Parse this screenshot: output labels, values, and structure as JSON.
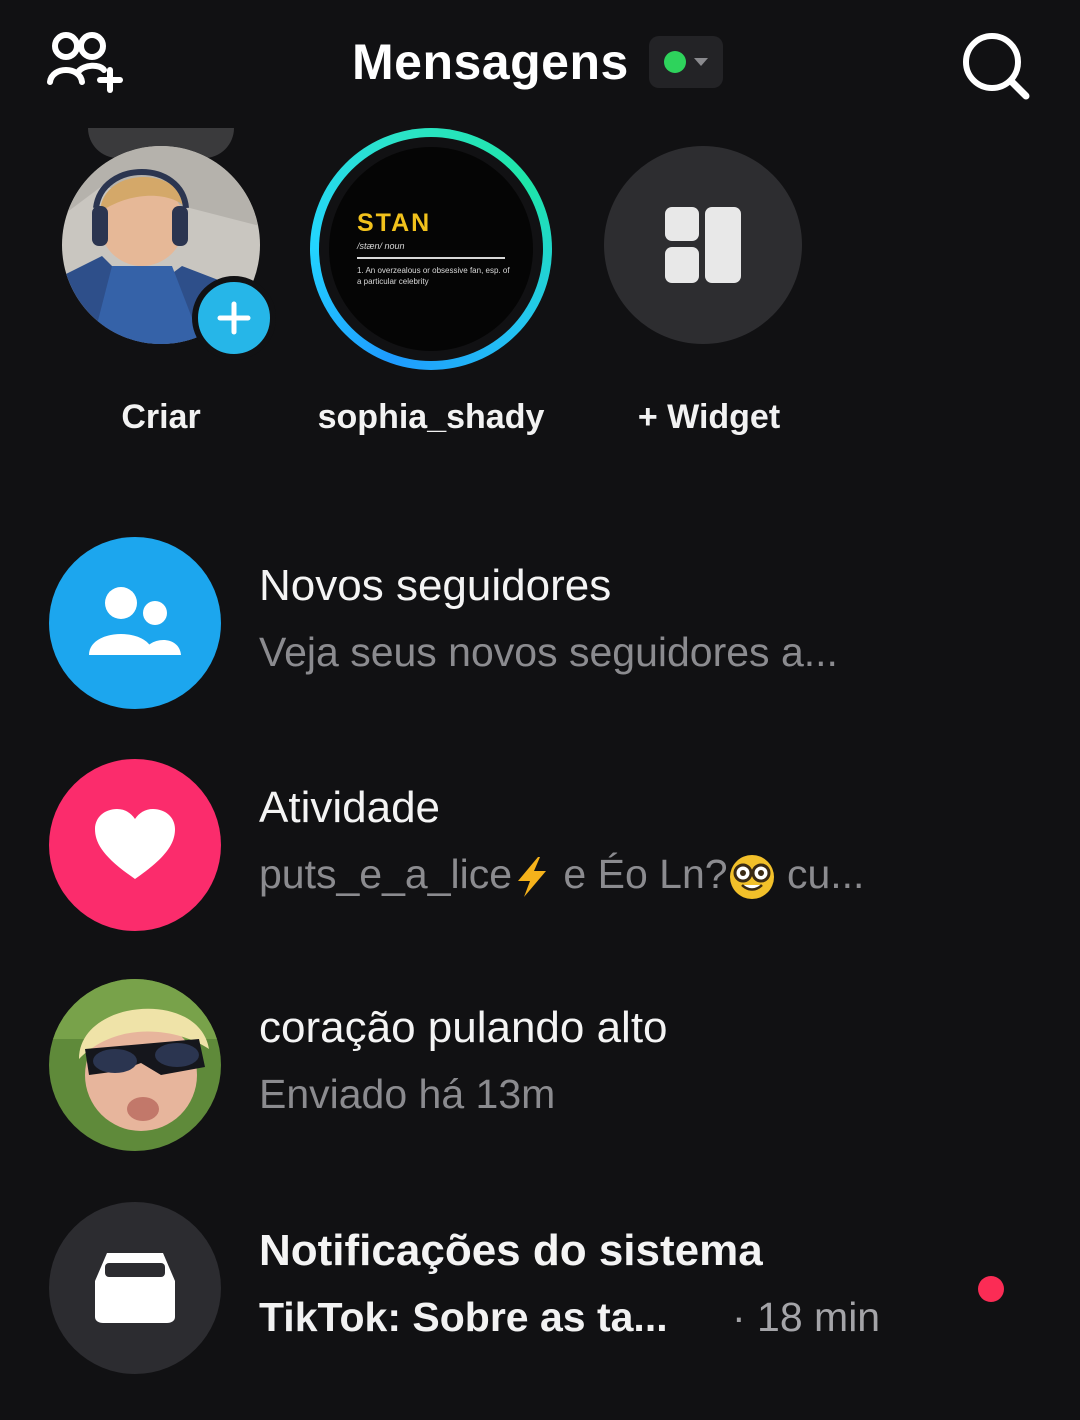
{
  "header": {
    "title": "Mensagens",
    "add_friends_icon": "add-friends-icon",
    "search_icon": "search-icon",
    "status_color": "#2ed35c"
  },
  "stories": [
    {
      "label": "Criar",
      "icon": "add-icon"
    },
    {
      "label": "sophia_shady",
      "card": {
        "word": "STAN",
        "phonetic": "/stæn/ noun",
        "definition": "1. An overzealous or obsessive fan, esp. of a particular celebrity"
      }
    },
    {
      "label": "+ Widget",
      "icon": "widget-icon"
    }
  ],
  "list": [
    {
      "title": "Novos seguidores",
      "subtitle": "Veja seus novos seguidores a...",
      "icon": "followers-icon",
      "color": "#1ca6ee"
    },
    {
      "title": "Atividade",
      "subtitle_parts": [
        "puts_e_a_lice",
        " e Éo Ln?",
        " cu..."
      ],
      "icon": "heart-icon",
      "color": "#fb2c6c"
    },
    {
      "title": "coração pulando alto",
      "subtitle": "Enviado há 13m"
    },
    {
      "title": "Notificações do sistema",
      "subtitle": "TikTok: Sobre as ta...",
      "time": "· 18 min",
      "icon": "inbox-icon",
      "unread_color": "#fb2c55"
    }
  ]
}
